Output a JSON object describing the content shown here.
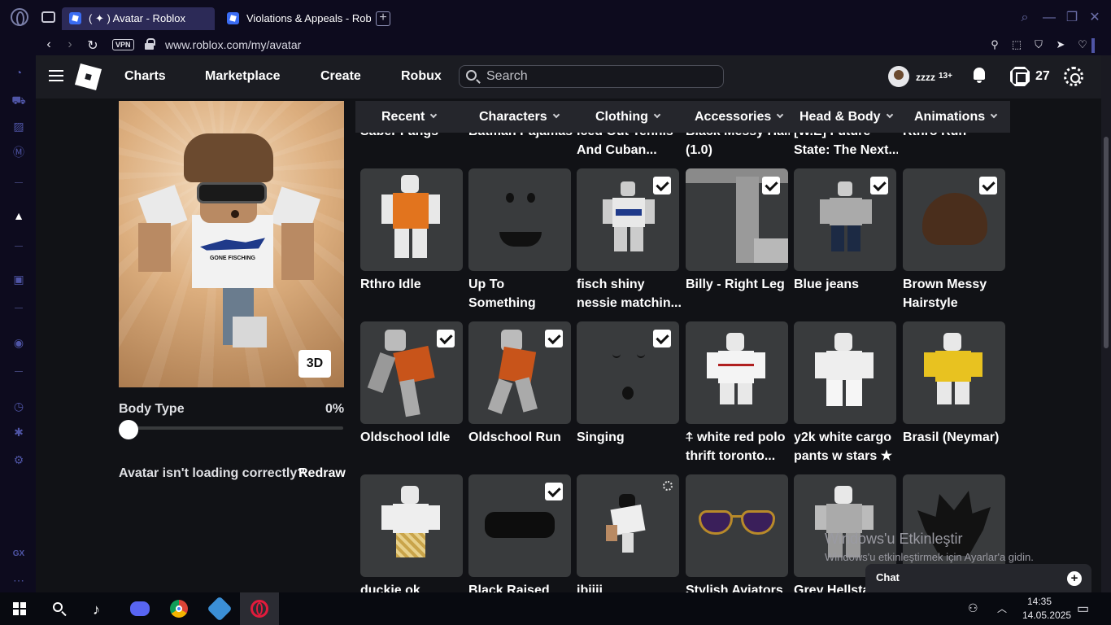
{
  "browser": {
    "tabs": [
      {
        "label": "( ✦ ) Avatar - Roblox"
      },
      {
        "label": "Violations & Appeals - Rob"
      }
    ],
    "vpn_label": "VPN",
    "url": "www.roblox.com/my/avatar"
  },
  "header": {
    "nav": [
      "Charts",
      "Marketplace",
      "Create",
      "Robux"
    ],
    "search_placeholder": "Search",
    "username": "zzzz",
    "age_badge": "13+",
    "robux": "27"
  },
  "avatar": {
    "button_3d": "3D",
    "body_type_label": "Body Type",
    "body_type_value": "0%",
    "body_type_fraction": 0,
    "redraw_note": "Avatar isn't loading correctly?",
    "redraw_link": "Redraw",
    "shirt_text": "GONE FISCHING"
  },
  "categories": [
    "Recent",
    "Characters",
    "Clothing",
    "Accessories",
    "Head & Body",
    "Animations"
  ],
  "top_partial_labels": [
    {
      "line1": "Saber Fangs",
      "line2": ""
    },
    {
      "line1": "Batman Pajamas",
      "line2": ""
    },
    {
      "line1": "Iced Out Tennis",
      "line2": "And Cuban..."
    },
    {
      "line1": "Black Messy Hair",
      "line2": "(1.0)"
    },
    {
      "line1": "[W.E] Future",
      "line2": "State: The Next..."
    },
    {
      "line1": "Rthro Run",
      "line2": ""
    }
  ],
  "items": [
    {
      "name": "Rthro Idle",
      "checked": false
    },
    {
      "name": "Up To Something",
      "checked": false
    },
    {
      "name": "fisch shiny nessie matchin...",
      "checked": true
    },
    {
      "name": "Billy - Right Leg",
      "checked": true
    },
    {
      "name": "Blue jeans",
      "checked": true
    },
    {
      "name": "Brown Messy Hairstyle",
      "checked": true
    },
    {
      "name": "Oldschool Idle",
      "checked": true
    },
    {
      "name": "Oldschool Run",
      "checked": true
    },
    {
      "name": "Singing",
      "checked": true
    },
    {
      "name": "⍏ white red polo thrift toronto...",
      "checked": false
    },
    {
      "name": "y2k white cargo pants w stars ★",
      "checked": false
    },
    {
      "name": "Brasil (Neymar)",
      "checked": false
    },
    {
      "name": "duckie ok",
      "checked": false
    },
    {
      "name": "Black Raised",
      "checked": true
    },
    {
      "name": "ibiiii",
      "checked": false,
      "gear": true
    },
    {
      "name": "Stylish Aviators",
      "checked": false
    },
    {
      "name": "Grey Hellsta",
      "checked": false
    },
    {
      "name": "",
      "checked": false
    }
  ],
  "watermark": {
    "line1": "Windows'u Etkinleştir",
    "line2": "Windows'u etkinleştirmek için Ayarlar'a gidin."
  },
  "chat": {
    "label": "Chat"
  },
  "taskbar": {
    "time": "14:35",
    "date": "14.05.2025"
  },
  "sidebar": {
    "gx_label": "GX"
  }
}
